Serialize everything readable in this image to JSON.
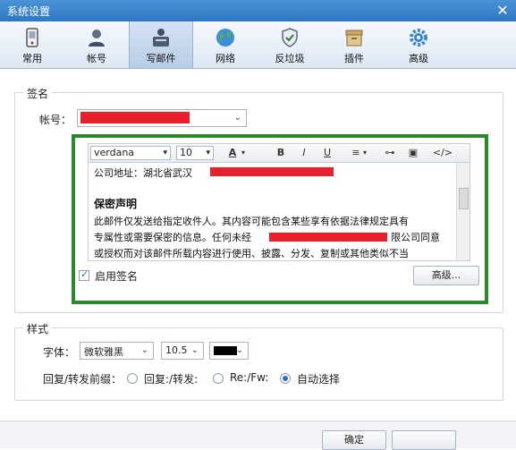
{
  "window": {
    "title": "系统设置",
    "close_glyph": "✕"
  },
  "toolbar": [
    {
      "label": "常用",
      "icon": "phone-icon"
    },
    {
      "label": "帐号",
      "icon": "user-icon"
    },
    {
      "label": "写邮件",
      "icon": "compose-icon",
      "active": true
    },
    {
      "label": "网络",
      "icon": "globe-icon"
    },
    {
      "label": "反垃圾",
      "icon": "shield-icon"
    },
    {
      "label": "插件",
      "icon": "plugin-box-icon"
    },
    {
      "label": "高级",
      "icon": "gear-icon"
    }
  ],
  "signature": {
    "group_title": "签名",
    "account_label": "帐号：",
    "editor": {
      "font": "verdana",
      "size": "10",
      "buttons": {
        "color": "A",
        "bold": "B",
        "italic": "I",
        "underline": "U",
        "list": "≡",
        "link": "⊶",
        "image": "▣",
        "source": "</>"
      },
      "lines": [
        "公司地址：湖北省武汉",
        "保密声明",
        "此邮件仅发送给指定收件人。其内容可能包含某些享有依据法律规定具有",
        "专属性或需要保密的信息。任何未经",
        "限公司同意",
        "或授权而对该邮件所载内容进行使用、披露、分发、复制或其他类似不当"
      ]
    },
    "enable_label": "启用签名",
    "enable_checked": true,
    "advanced_button": "高级..."
  },
  "style": {
    "group_title": "样式",
    "font_label": "字体：",
    "font_value": "微软雅黑",
    "size_value": "10.5",
    "color_value": "#000000",
    "reply_label": "回复/转发前缀：",
    "options": [
      "回复:/转发:",
      "Re:/Fw:",
      "自动选择"
    ],
    "selected_option": 2
  },
  "footer": {
    "ok_button": "确定"
  }
}
